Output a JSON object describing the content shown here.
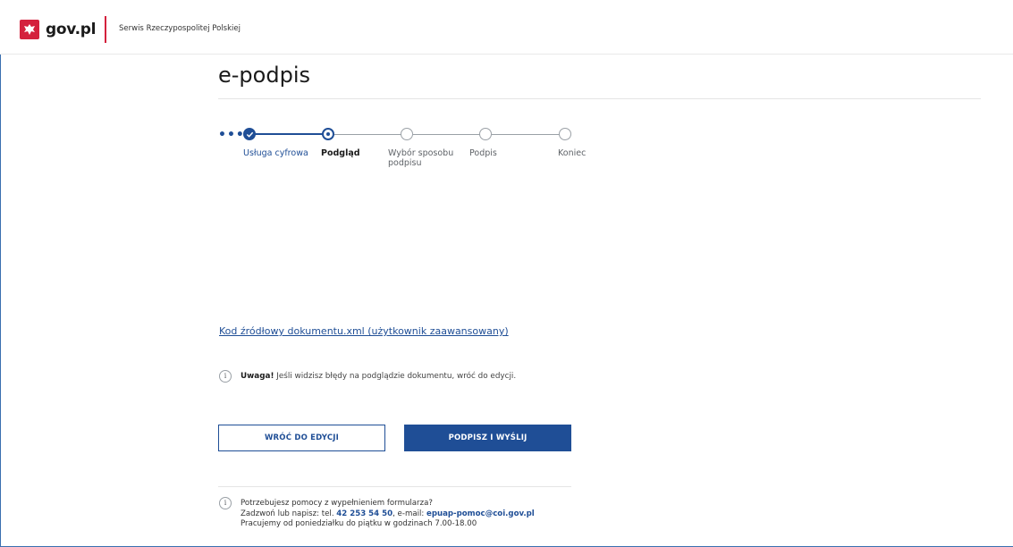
{
  "header": {
    "logo_text": "gov.pl",
    "service_name": "Serwis Rzeczypospolitej Polskiej"
  },
  "page": {
    "title": "e-podpis"
  },
  "stepper": {
    "more_indicator": "•••",
    "steps": [
      {
        "label": "Usługa cyfrowa",
        "state": "done"
      },
      {
        "label": "Podgląd",
        "state": "current"
      },
      {
        "label_line1": "Wybór sposobu",
        "label_line2": "podpisu",
        "state": "pending"
      },
      {
        "label": "Podpis",
        "state": "pending"
      },
      {
        "label": "Koniec",
        "state": "pending"
      }
    ]
  },
  "source_link": "Kod źródłowy dokumentu.xml (użytkownik zaawansowany)",
  "warning": {
    "icon": "info-icon",
    "bold": "Uwaga!",
    "text": " Jeśli widzisz błędy na podglądzie dokumentu, wróć do edycji."
  },
  "buttons": {
    "back": "WRÓĆ DO EDYCJI",
    "sign": "PODPISZ I WYŚLIJ"
  },
  "help": {
    "icon": "info-icon",
    "line1": "Potrzebujesz pomocy z wypełnieniem formularza?",
    "line2_prefix": "Zadzwoń lub napisz: tel. ",
    "phone": "42 253 54 50",
    "line2_mid": ", e-mail: ",
    "email": "epuap-pomoc@coi.gov.pl",
    "line3": "Pracujemy od poniedziałku do piątku w godzinach 7.00-18.00"
  },
  "colors": {
    "primary": "#1f4e96",
    "brand_red": "#d4213d",
    "border": "#3a6fb0"
  }
}
